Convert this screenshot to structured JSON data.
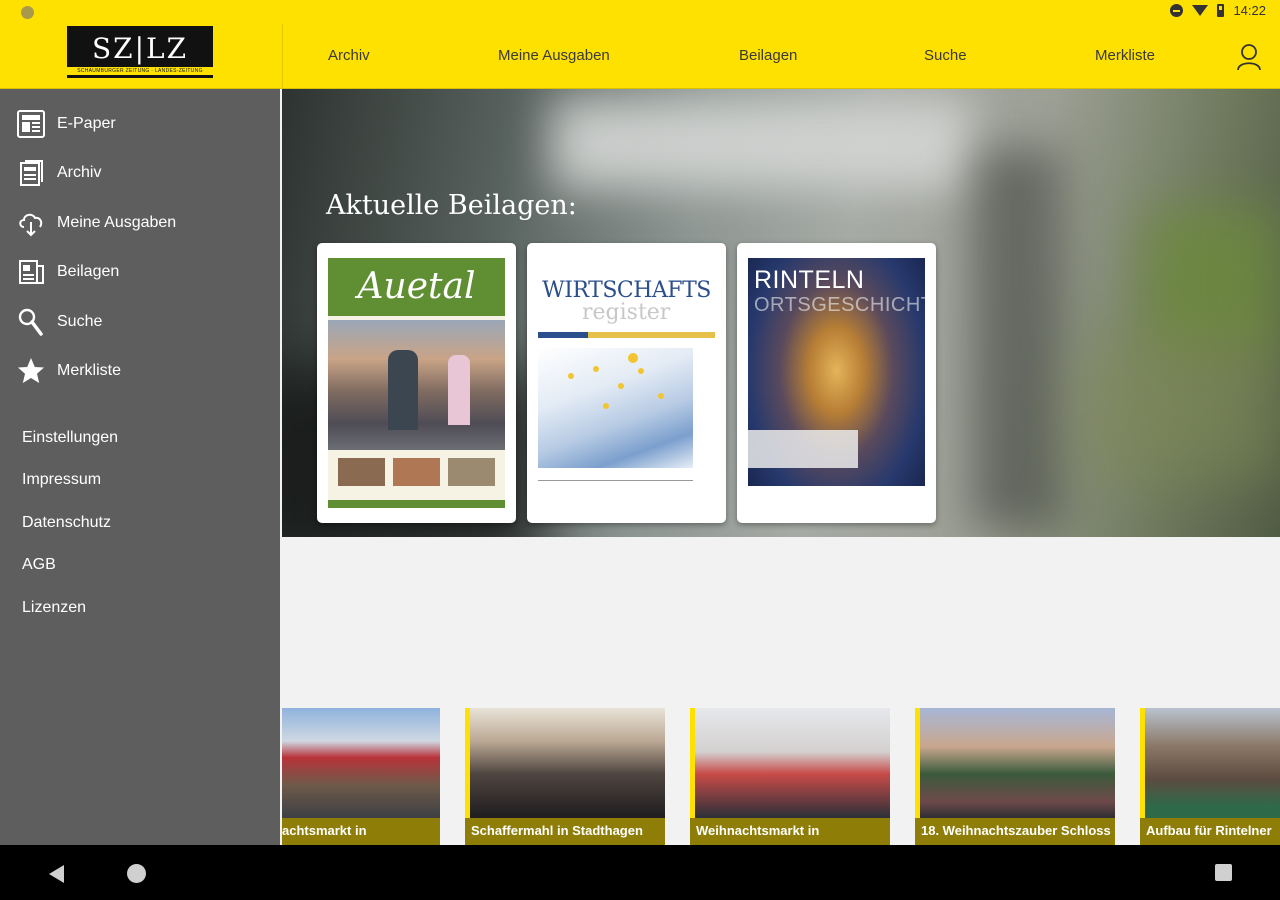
{
  "status_bar": {
    "time": "14:22"
  },
  "logo": {
    "text": "SZ|LZ",
    "subtitle": "SCHAUMBURGER ZEITUNG · LANDES-ZEITUNG"
  },
  "top_nav": [
    {
      "label": "Archiv"
    },
    {
      "label": "Meine Ausgaben"
    },
    {
      "label": "Beilagen"
    },
    {
      "label": "Suche"
    },
    {
      "label": "Merkliste"
    }
  ],
  "sidebar": {
    "items": [
      {
        "label": "E-Paper",
        "icon": "newspaper-icon"
      },
      {
        "label": "Archiv",
        "icon": "archive-icon"
      },
      {
        "label": "Meine Ausgaben",
        "icon": "cloud-download-icon"
      },
      {
        "label": "Beilagen",
        "icon": "supplements-icon"
      },
      {
        "label": "Suche",
        "icon": "search-icon"
      },
      {
        "label": "Merkliste",
        "icon": "star-icon"
      }
    ],
    "links": [
      {
        "label": "Einstellungen"
      },
      {
        "label": "Impressum"
      },
      {
        "label": "Datenschutz"
      },
      {
        "label": "AGB"
      },
      {
        "label": "Lizenzen"
      }
    ]
  },
  "hero": {
    "title": "Aktuelle Beilagen:",
    "covers": [
      {
        "title": "Auetal"
      },
      {
        "title": "WIRTSCHAFTS",
        "subtitle": "register"
      },
      {
        "title": "RINTELN",
        "subtitle": "ORTSGESCHICHT"
      }
    ]
  },
  "news": [
    {
      "caption": "achtsmarkt in"
    },
    {
      "caption": "Schaffermahl in Stadthagen"
    },
    {
      "caption": "Weihnachtsmarkt in"
    },
    {
      "caption": "18. Weihnachtszauber Schloss"
    },
    {
      "caption": "Aufbau für Rintelner"
    }
  ],
  "colors": {
    "brand_yellow": "#ffe100",
    "sidebar_gray": "#5e5e5e",
    "caption_olive": "#8e7e08"
  }
}
